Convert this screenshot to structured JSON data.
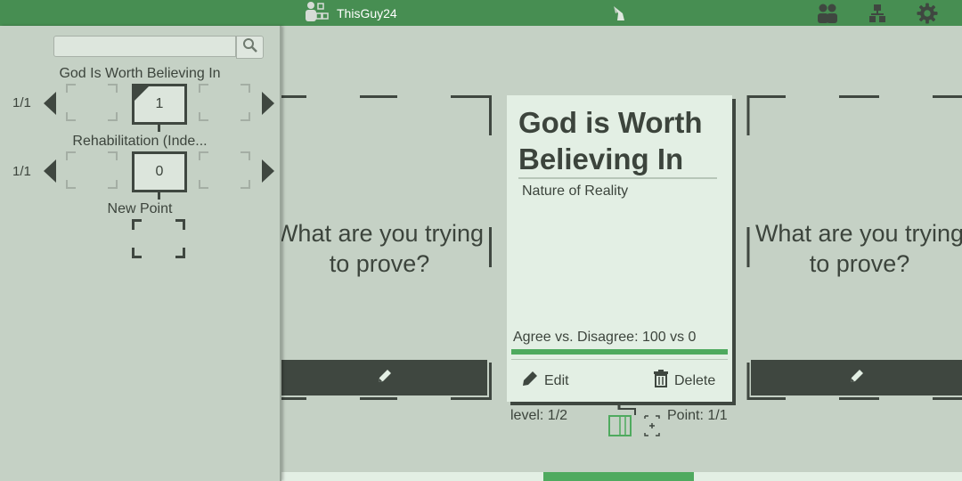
{
  "topbar": {
    "username": "ThisGuy24",
    "user_icon": "user-tree-icon",
    "logo_icon": "goat-logo-icon",
    "right_icons": [
      "users-icon",
      "hierarchy-icon",
      "settings-gear-icon"
    ]
  },
  "sidebar": {
    "search_placeholder": "",
    "rows": [
      {
        "label": "God Is Worth Believing In",
        "pager": "1/1",
        "value": "1"
      },
      {
        "label": "Rehabilitation (Inde...",
        "pager": "1/1",
        "value": "0"
      },
      {
        "label": "New Point"
      }
    ]
  },
  "main": {
    "ghost_prompt": "What are you trying to prove?",
    "card": {
      "title": "God is Worth Believing In",
      "subtitle": "Nature of Reality",
      "agree_text": "Agree vs. Disagree: 100 vs 0",
      "agree_fraction": 1.0,
      "edit_label": "Edit",
      "delete_label": "Delete"
    },
    "level_text": "level: 1/2",
    "point_text": "Point: 1/1"
  },
  "colors": {
    "accent_green": "#478e52",
    "bar_green": "#4faa5f",
    "card_bg": "#e3efe4",
    "dark": "#3f4740"
  }
}
